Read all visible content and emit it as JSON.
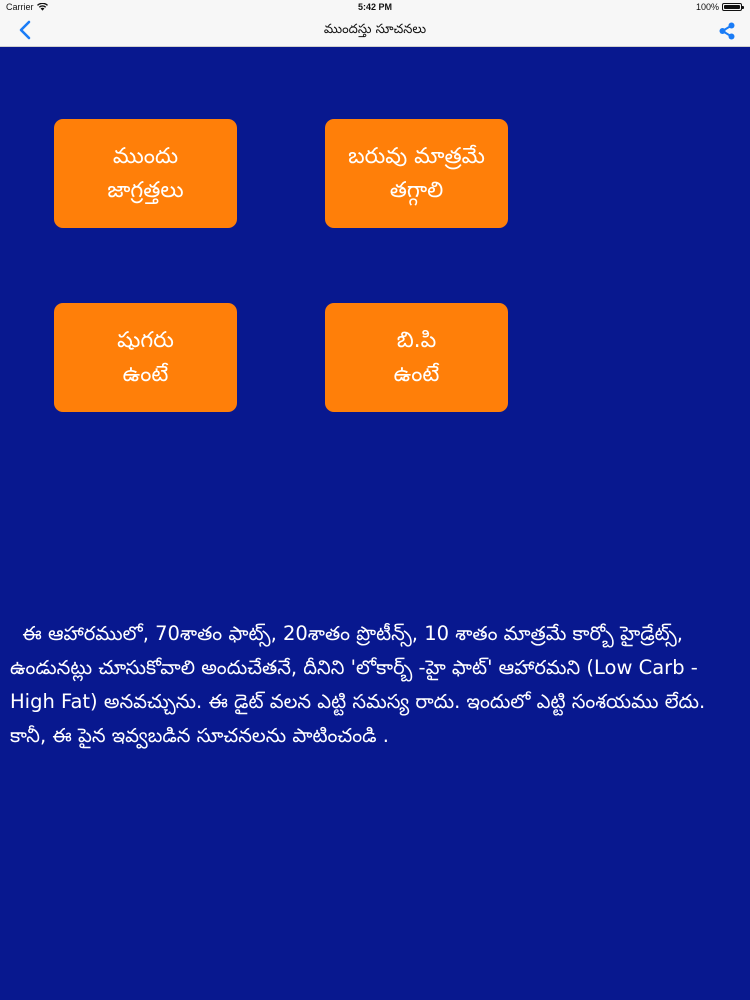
{
  "status_bar": {
    "carrier": "Carrier",
    "time": "5:42 PM",
    "battery": "100%",
    "wifi_icon": "wifi-icon",
    "battery_icon": "battery-icon"
  },
  "nav_bar": {
    "title": "ముందస్తు సూచనలు",
    "back_icon": "chevron-left-icon",
    "share_icon": "share-icon"
  },
  "colors": {
    "background": "#08188f",
    "tile": "#ff7f09",
    "tint": "#1a7cf6"
  },
  "tiles": [
    {
      "line1": "ముందు",
      "line2": "జాగ్రత్తలు"
    },
    {
      "line1": "బరువు మాత్రమే",
      "line2": "తగ్గాలి"
    },
    {
      "line1": "షుగరు",
      "line2": "ఉంటే"
    },
    {
      "line1": "బి.పి",
      "line2": "ఉంటే"
    }
  ],
  "body_text": "  ఈ ఆహారములో, 70శాతం ఫాట్స్, 20శాతం ప్రొటీన్స్, 10 శాతం మాత్రమే కార్బో హైడ్రేట్స్, ఉండునట్లు చూసుకోవాలి అందుచేతనే, దీనిని 'లోకార్బ్ -హై ఫాట్' ఆహారమని (Low Carb - High Fat) అనవచ్చును. ఈ డైట్ వలన ఎట్టి సమస్య రాదు. ఇందులో ఎట్టి సంశయము లేదు. కానీ, ఈ పైన ఇవ్వబడిన సూచనలను పాటించండి ."
}
